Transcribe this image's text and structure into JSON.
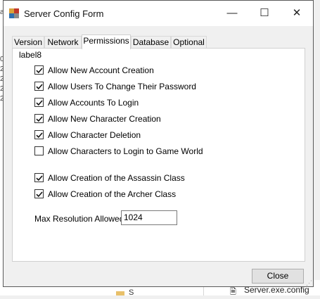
{
  "background": {
    "left_fragments": [
      "a",
      "0",
      "2",
      "2",
      "2",
      "2"
    ],
    "bottom": {
      "folder_label": "S",
      "file_label": "Server.exe.config"
    }
  },
  "window": {
    "title": "Server Config Form",
    "icon": "app-grid-icon",
    "controls": {
      "minimize": "—",
      "maximize": "☐",
      "close": "✕"
    }
  },
  "tabs": [
    {
      "label": "Version",
      "active": false
    },
    {
      "label": "Network",
      "active": false
    },
    {
      "label": "Permissions",
      "active": true
    },
    {
      "label": "Database",
      "active": false
    },
    {
      "label": "Optional",
      "active": false
    }
  ],
  "permissions": {
    "group_label": "label8",
    "options": [
      {
        "label": "Allow New Account Creation",
        "checked": true
      },
      {
        "label": "Allow Users To Change Their Password",
        "checked": true
      },
      {
        "label": "Allow Accounts To Login",
        "checked": true
      },
      {
        "label": "Allow New Character Creation",
        "checked": true
      },
      {
        "label": "Allow Character Deletion",
        "checked": true
      },
      {
        "label": "Allow Characters to Login to Game World",
        "checked": false
      }
    ],
    "class_options": [
      {
        "label": "Allow Creation of the Assassin Class",
        "checked": true
      },
      {
        "label": "Allow Creation of the Archer Class",
        "checked": true
      }
    ],
    "max_resolution": {
      "label": "Max Resolution Allowed",
      "value": "1024"
    }
  },
  "buttons": {
    "close": "Close"
  },
  "colors": {
    "titlebar": "#ffffff",
    "form_bg": "#f0f0f0",
    "panel_bg": "#ffffff",
    "button_bg": "#e1e1e1"
  }
}
